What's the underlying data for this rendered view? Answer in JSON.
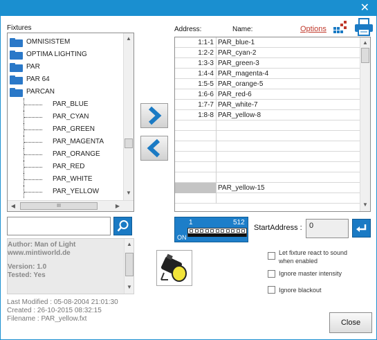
{
  "window": {
    "close_glyph": "✕"
  },
  "left": {
    "fixtures_label": "Fixtures",
    "tree": {
      "folders": [
        "OMNISISTEM",
        "OPTIMA LIGHTING",
        "PAR",
        "PAR 64",
        "PARCAN"
      ],
      "children": [
        "PAR_BLUE",
        "PAR_CYAN",
        "PAR_GREEN",
        "PAR_MAGENTA",
        "PAR_ORANGE",
        "PAR_RED",
        "PAR_WHITE",
        "PAR_YELLOW"
      ]
    },
    "hscroll_grip": "III",
    "search": {
      "value": "",
      "icon": "search-icon"
    },
    "info": {
      "author": "Author: Man of Light",
      "website": "www.mintiworld.de",
      "version": "Version: 1.0",
      "tested": "Tested: Yes"
    },
    "meta": {
      "last_modified": "Last Modified : 05-08-2004 21:01:30",
      "created": "Created : 26-10-2015 08:32:15",
      "filename": "Filename : PAR_yellow.fxt"
    }
  },
  "middle": {
    "add_icon": "chevron-right-icon",
    "remove_icon": "chevron-left-icon"
  },
  "right": {
    "address_header": "Address:",
    "name_header": "Name:",
    "options_link": "Options",
    "icons": [
      "grid-layout-icon",
      "printer-icon"
    ],
    "rows": [
      {
        "address": "1:1-1",
        "name": "PAR_blue-1"
      },
      {
        "address": "1:2-2",
        "name": "PAR_cyan-2"
      },
      {
        "address": "1:3-3",
        "name": "PAR_green-3"
      },
      {
        "address": "1:4-4",
        "name": "PAR_magenta-4"
      },
      {
        "address": "1:5-5",
        "name": "PAR_orange-5"
      },
      {
        "address": "1:6-6",
        "name": "PAR_red-6"
      },
      {
        "address": "1:7-7",
        "name": "PAR_white-7"
      },
      {
        "address": "1:8-8",
        "name": "PAR_yellow-8"
      }
    ],
    "drag_row": {
      "name": "PAR_yellow-15"
    },
    "dmx": {
      "start": "1",
      "end": "512",
      "on_label": "ON"
    },
    "start_address": {
      "label": "StartAddress :",
      "value": "0"
    },
    "options": [
      {
        "label_line1": "Let fixture react to sound",
        "label_line2": "when enabled",
        "checked": false
      },
      {
        "label_line1": "Ignore master intensity",
        "label_line2": "",
        "checked": false
      },
      {
        "label_line1": "Ignore blackout",
        "label_line2": "",
        "checked": false
      }
    ],
    "close_label": "Close",
    "fixture_image": "par-can-icon",
    "accent": "#1a7ac4"
  }
}
